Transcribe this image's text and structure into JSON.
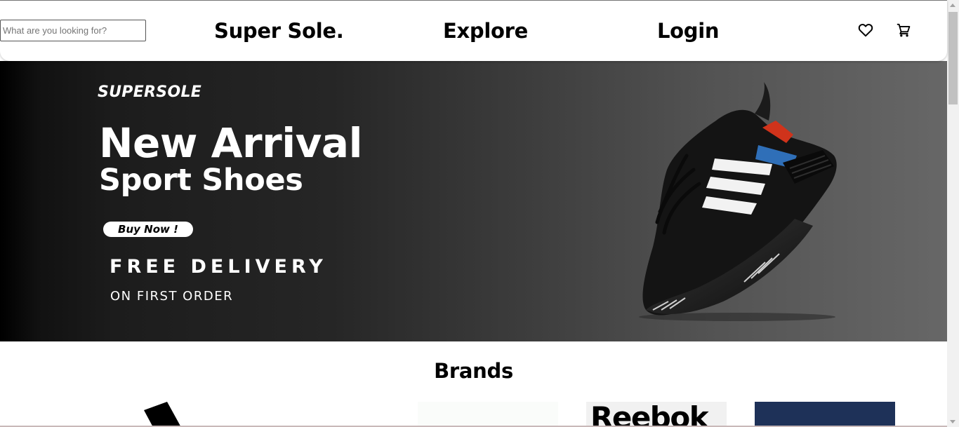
{
  "header": {
    "search_placeholder": "What are you looking for?",
    "brand_link": "Super Sole.",
    "explore_link": "Explore",
    "login_link": "Login",
    "icons": [
      "heart-icon",
      "cart-icon"
    ]
  },
  "hero": {
    "brand": "SUPERSOLE",
    "title_line1": "New Arrival",
    "title_line2": "Sport Shoes",
    "buy_button": "Buy Now !",
    "free_delivery": "FREE DELIVERY",
    "first_order": "ON FIRST ORDER"
  },
  "brands": {
    "title": "Brands",
    "reebok_logo": "Reebok"
  },
  "colors": {
    "text": "#000000",
    "background": "#ffffff",
    "hero_dark": "#000000",
    "hero_light": "#676767",
    "brand_navy": "#1e3158"
  }
}
